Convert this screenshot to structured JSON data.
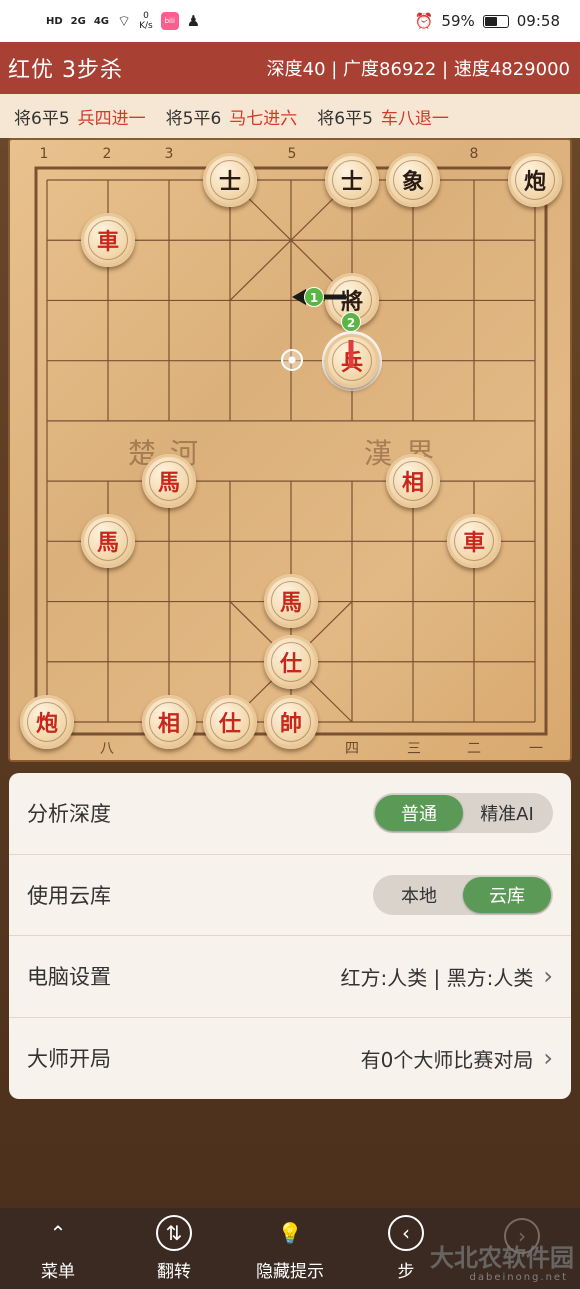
{
  "status_bar": {
    "hd_label": "HD",
    "net1": "2G",
    "net2": "4G",
    "speed_value": "0",
    "speed_unit": "K/s",
    "battery": "59%",
    "battery_level": 0.59,
    "time": "09:58"
  },
  "header": {
    "title": "红优 3步杀",
    "stats": "深度40 | 广度86922 | 速度4829000"
  },
  "moves": [
    {
      "black": "将6平5",
      "red": "兵四进一"
    },
    {
      "black": "将5平6",
      "red": "马七进六"
    },
    {
      "black": "将6平5",
      "red": "车八退一"
    }
  ],
  "board": {
    "top_labels": [
      "1",
      "2",
      "3",
      "5",
      "8"
    ],
    "bottom_labels": [
      "八",
      "四",
      "三",
      "二",
      "一"
    ],
    "river_left": "楚河",
    "river_right": "漢界",
    "markers": [
      "1",
      "2"
    ],
    "pieces": [
      {
        "char": "士",
        "side": "black"
      },
      {
        "char": "士",
        "side": "black"
      },
      {
        "char": "象",
        "side": "black"
      },
      {
        "char": "炮",
        "side": "black"
      },
      {
        "char": "車",
        "side": "red"
      },
      {
        "char": "將",
        "side": "black"
      },
      {
        "char": "兵",
        "side": "red"
      },
      {
        "char": "馬",
        "side": "red"
      },
      {
        "char": "相",
        "side": "red"
      },
      {
        "char": "馬",
        "side": "red"
      },
      {
        "char": "車",
        "side": "red"
      },
      {
        "char": "馬",
        "side": "red"
      },
      {
        "char": "仕",
        "side": "red"
      },
      {
        "char": "炮",
        "side": "red"
      },
      {
        "char": "相",
        "side": "red"
      },
      {
        "char": "仕",
        "side": "red"
      },
      {
        "char": "帥",
        "side": "red"
      }
    ]
  },
  "settings": {
    "depth_label": "分析深度",
    "depth_opt1": "普通",
    "depth_opt2": "精准AI",
    "cloud_label": "使用云库",
    "cloud_opt1": "本地",
    "cloud_opt2": "云库",
    "computer_label": "电脑设置",
    "computer_value": "红方:人类 | 黑方:人类",
    "master_label": "大师开局",
    "master_value": "有0个大师比赛对局"
  },
  "nav": {
    "menu": "菜单",
    "flip": "翻转",
    "hint": "隐藏提示",
    "step": "步"
  },
  "watermark": {
    "main": "大北农软件园",
    "sub": "dabeinong.net"
  },
  "colors": {
    "title_bg": "#a84034",
    "red_piece": "#c8281c",
    "toggle_on": "#5a9a56",
    "nav_bg": "#3b2a22"
  }
}
